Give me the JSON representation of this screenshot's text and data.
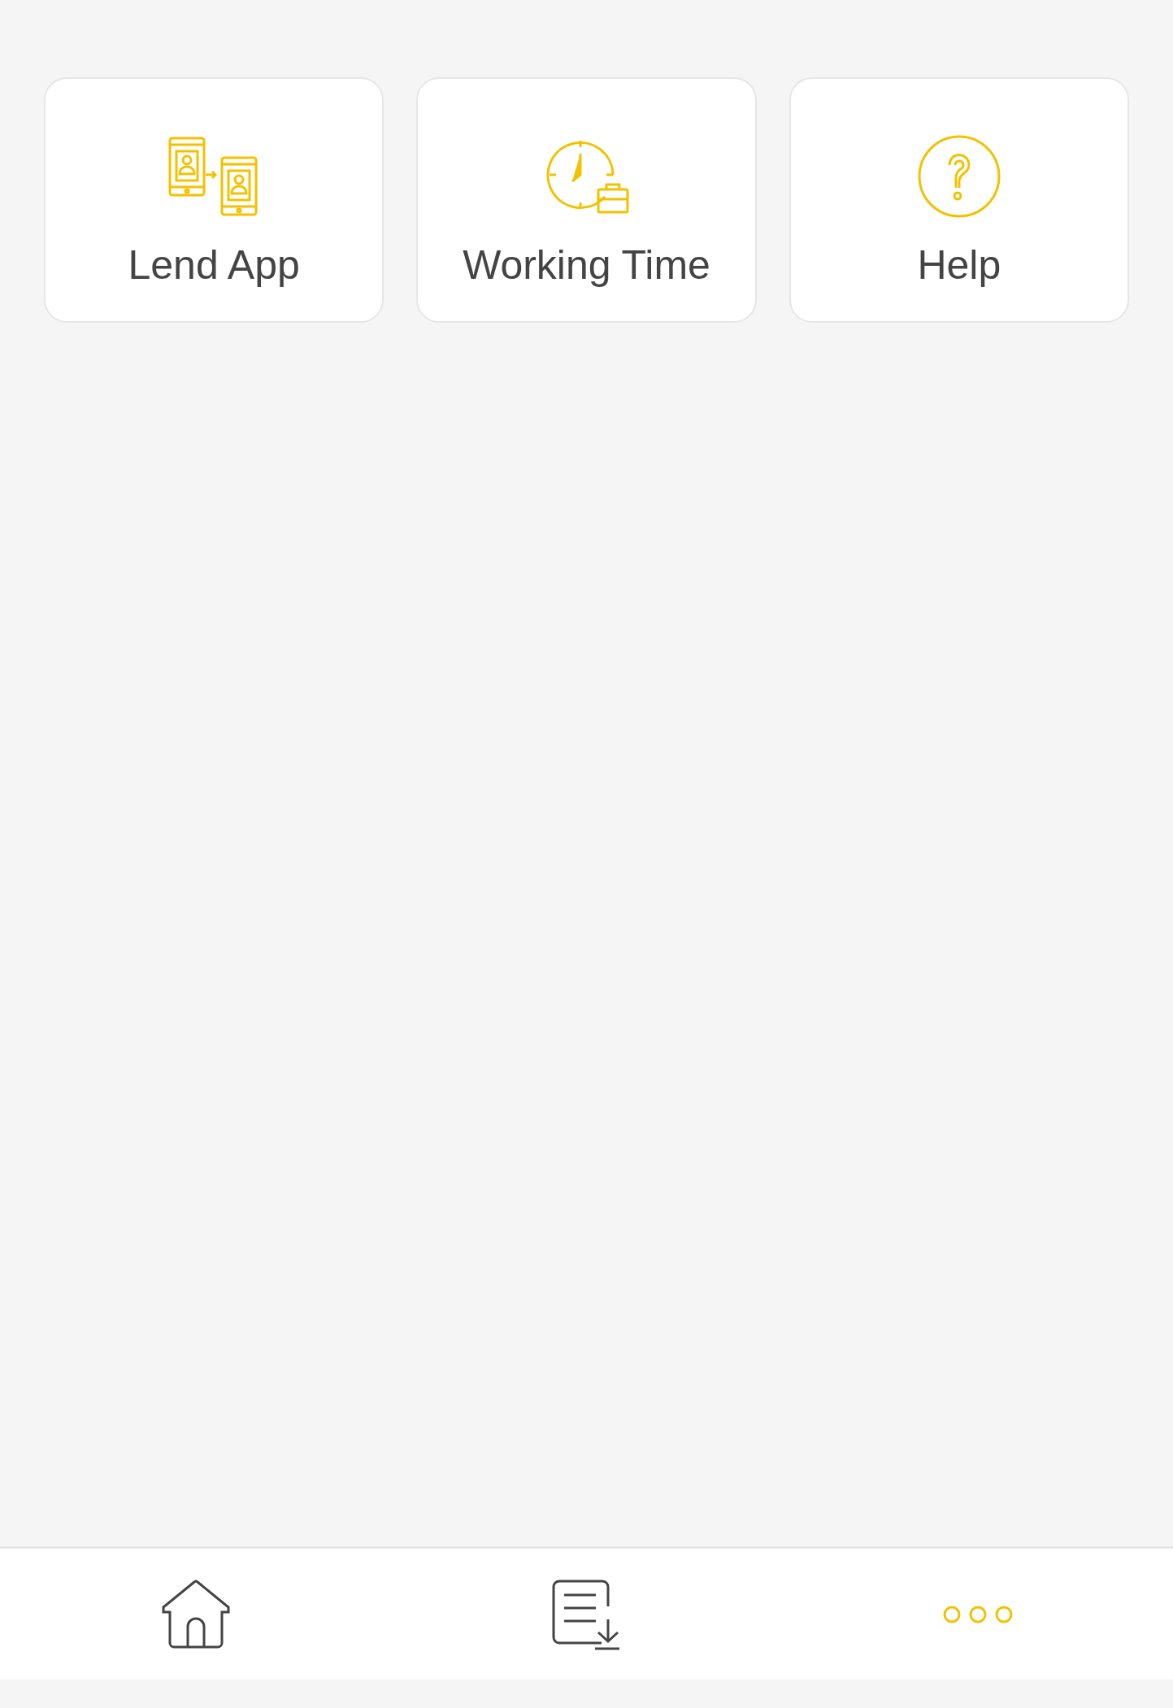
{
  "tiles": [
    {
      "label": "Lend App"
    },
    {
      "label": "Working Time"
    },
    {
      "label": "Help"
    }
  ],
  "bottom_nav": [
    {
      "selected": false
    },
    {
      "selected": false
    },
    {
      "selected": true
    }
  ]
}
